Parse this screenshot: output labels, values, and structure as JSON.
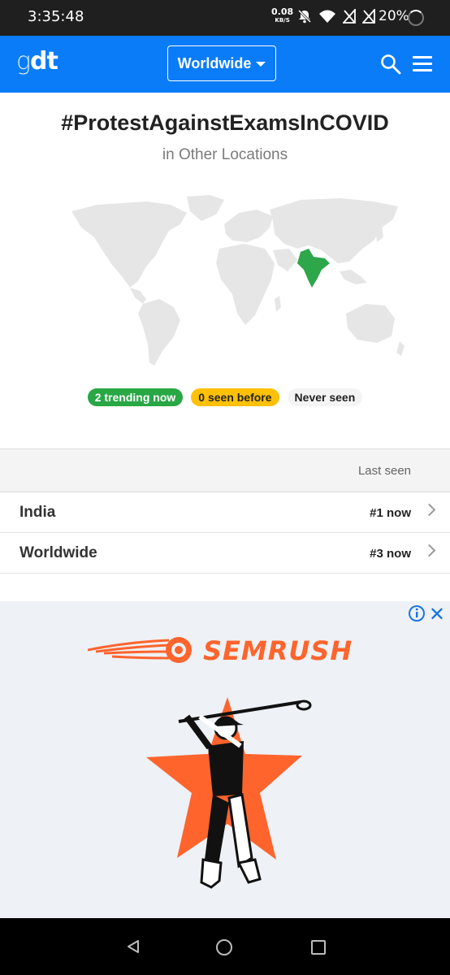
{
  "status_bar": {
    "time": "3:35:48",
    "net_speed": "0.08",
    "net_unit": "KB/S",
    "battery": "20%"
  },
  "header": {
    "logo_light": "g",
    "logo_bold": "dt",
    "region": "Worldwide",
    "accent_color": "#0a7cf7"
  },
  "page": {
    "title": "#ProtestAgainstExamsInCOVID",
    "subtitle": "in Other Locations"
  },
  "map": {
    "highlighted_country": "India",
    "highlight_color": "#2ea64a",
    "base_color": "#e6e6e6"
  },
  "legend": {
    "trending": "2 trending now",
    "seen_before": "0 seen before",
    "never_seen": "Never seen"
  },
  "table": {
    "column_header": "Last seen",
    "rows": [
      {
        "name": "India",
        "rank": "#1 now"
      },
      {
        "name": "Worldwide",
        "rank": "#3 now"
      }
    ]
  },
  "ad": {
    "brand": "SEMRUSH",
    "brand_color": "#ff642d"
  }
}
